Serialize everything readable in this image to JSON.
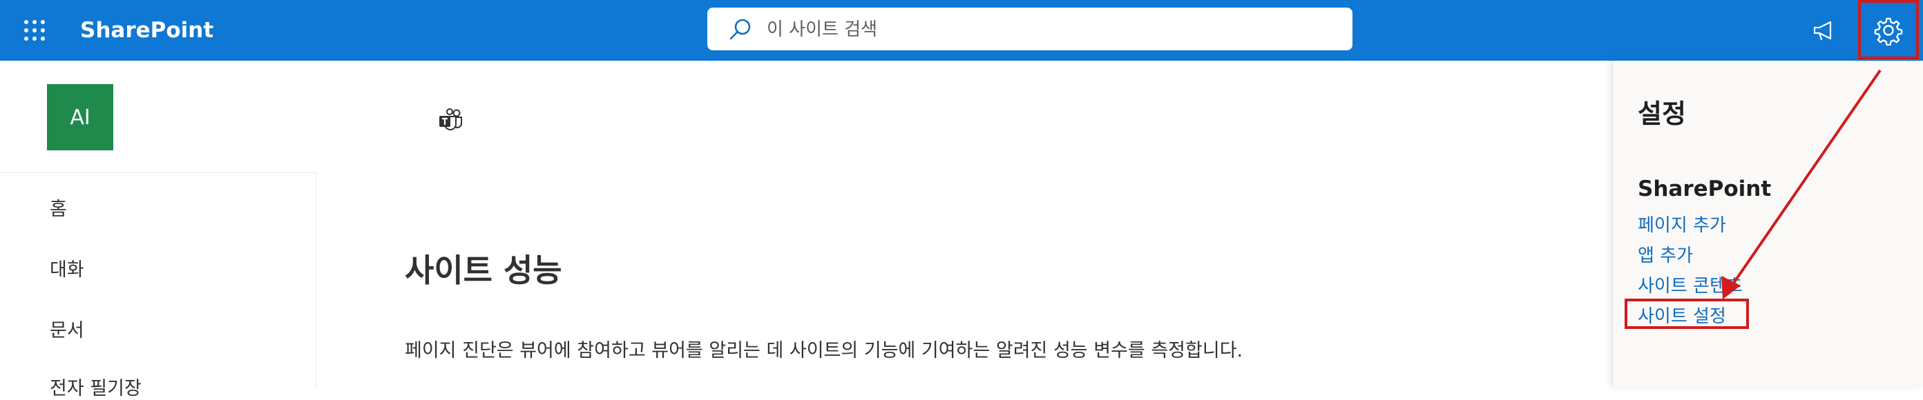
{
  "header": {
    "app_name": "SharePoint",
    "search_placeholder": "이 사이트 검색",
    "accent": "#0f78d4"
  },
  "site": {
    "logo_text": "AI",
    "logo_color": "#1f8a4c"
  },
  "nav": {
    "items": [
      {
        "label": "홈"
      },
      {
        "label": "대화"
      },
      {
        "label": "문서"
      },
      {
        "label": "전자 필기장"
      }
    ]
  },
  "main": {
    "title": "사이트 성능",
    "description": "페이지 진단은 뷰어에 참여하고 뷰어를 알리는 데 사이트의 기능에 기여하는 알려진 성능 변수를 측정합니다."
  },
  "settings_panel": {
    "title": "설정",
    "section": "SharePoint",
    "links": [
      {
        "label": "페이지 추가"
      },
      {
        "label": "앱 추가"
      },
      {
        "label": "사이트 콘텐츠"
      },
      {
        "label": "사이트 설정"
      }
    ],
    "highlight_color": "#d01c1c"
  },
  "icons": [
    "app-launcher-icon",
    "search-icon",
    "megaphone-icon",
    "gear-icon",
    "teams-icon"
  ]
}
